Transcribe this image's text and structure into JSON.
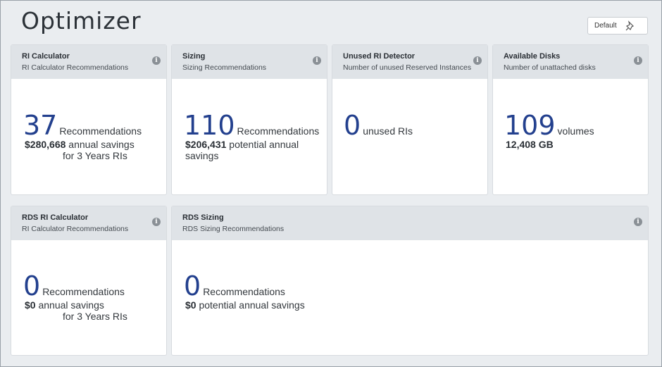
{
  "page": {
    "title": "Optimizer"
  },
  "toolbar": {
    "default_label": "Default"
  },
  "cards": [
    {
      "title": "RI Calculator",
      "subtitle": "RI Calculator Recommendations",
      "value": "37",
      "unit": "Recommendations",
      "amount": "$280,668",
      "amount_text": " annual savings",
      "extra": "for 3 Years RIs"
    },
    {
      "title": "Sizing",
      "subtitle": "Sizing Recommendations",
      "value": "110",
      "unit": "Recommendations",
      "amount": "$206,431",
      "amount_text": " potential annual",
      "extra": "savings"
    },
    {
      "title": "Unused RI Detector",
      "subtitle": "Number of unused Reserved Instances",
      "value": "0",
      "unit": "unused RIs"
    },
    {
      "title": "Available Disks",
      "subtitle": "Number of unattached disks",
      "value": "109",
      "unit": "volumes",
      "amount": "12,408 GB"
    },
    {
      "title": "RDS RI Calculator",
      "subtitle": "RI Calculator Recommendations",
      "value": "0",
      "unit": "Recommendations",
      "amount": "$0",
      "amount_text": " annual savings",
      "extra": "for 3 Years RIs"
    },
    {
      "title": "RDS Sizing",
      "subtitle": "RDS Sizing Recommendations",
      "value": "0",
      "unit": "Recommendations",
      "amount": "$0",
      "amount_text": " potential annual savings"
    }
  ]
}
